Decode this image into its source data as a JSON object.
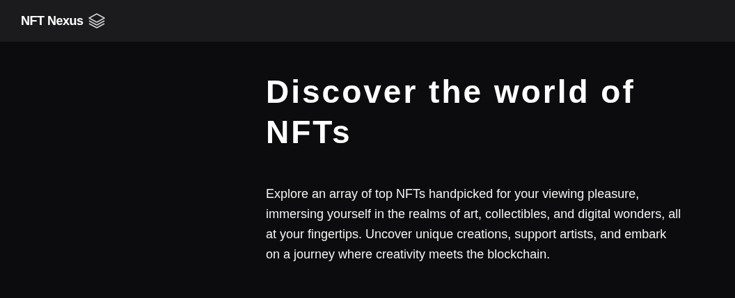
{
  "header": {
    "brand": "NFT Nexus"
  },
  "hero": {
    "title": "Discover the world of NFTs",
    "description": "Explore an array of top NFTs handpicked for your viewing pleasure, immersing yourself in the realms of art, collectibles, and digital wonders, all at your fingertips. Uncover unique creations, support artists, and embark on a journey where creativity meets the blockchain."
  }
}
